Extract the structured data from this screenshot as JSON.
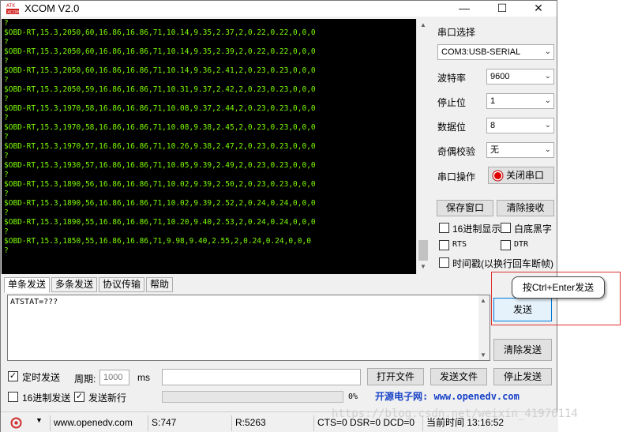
{
  "window": {
    "title": "XCOM V2.0",
    "minimize": "—",
    "maximize": "☐",
    "close": "✕"
  },
  "terminal": {
    "lines": [
      "?",
      "$OBD-RT,15.3,2050,60,16.86,16.86,71,10.14,9.35,2.37,2,0.22,0.22,0,0,0",
      "?",
      "$OBD-RT,15.3,2050,60,16.86,16.86,71,10.14,9.35,2.39,2,0.22,0.22,0,0,0",
      "?",
      "$OBD-RT,15.3,2050,60,16.86,16.86,71,10.14,9.36,2.41,2,0.23,0.23,0,0,0",
      "?",
      "$OBD-RT,15.3,2050,59,16.86,16.86,71,10.31,9.37,2.42,2,0.23,0.23,0,0,0",
      "?",
      "$OBD-RT,15.3,1970,58,16.86,16.86,71,10.08,9.37,2.44,2,0.23,0.23,0,0,0",
      "?",
      "$OBD-RT,15.3,1970,58,16.86,16.86,71,10.08,9.38,2.45,2,0.23,0.23,0,0,0",
      "?",
      "$OBD-RT,15.3,1970,57,16.86,16.86,71,10.26,9.38,2.47,2,0.23,0.23,0,0,0",
      "?",
      "$OBD-RT,15.3,1930,57,16.86,16.86,71,10.05,9.39,2.49,2,0.23,0.23,0,0,0",
      "?",
      "$OBD-RT,15.3,1890,56,16.86,16.86,71,10.02,9.39,2.50,2,0.23,0.23,0,0,0",
      "?",
      "$OBD-RT,15.3,1890,56,16.86,16.86,71,10.02,9.39,2.52,2,0.24,0.24,0,0,0",
      "?",
      "$OBD-RT,15.3,1890,55,16.86,16.86,71,10.20,9.40,2.53,2,0.24,0.24,0,0,0",
      "?",
      "$OBD-RT,15.3,1850,55,16.86,16.86,71,9.98,9.40,2.55,2,0.24,0.24,0,0,0",
      "?"
    ]
  },
  "settings": {
    "port_label": "串口选择",
    "port_value": "COM3:USB-SERIAL",
    "baud_label": "波特率",
    "baud_value": "9600",
    "stopbit_label": "停止位",
    "stopbit_value": "1",
    "databit_label": "数据位",
    "databit_value": "8",
    "parity_label": "奇偶校验",
    "parity_value": "无",
    "port_op_label": "串口操作",
    "close_port_label": "关闭串口",
    "save_window_label": "保存窗口",
    "clear_receive_label": "清除接收",
    "hex_display_label": "16进制显示",
    "white_bg_label": "白底黑字",
    "rts_label": "RTS",
    "dtr_label": "DTR",
    "timestamp_label": "时间戳(以换行回车断帧)"
  },
  "tabs": [
    "单条发送",
    "多条发送",
    "协议传输",
    "帮助"
  ],
  "send": {
    "text": "ATSTAT=???",
    "send_label": "发送",
    "clear_send_label": "清除发送",
    "tooltip": "按Ctrl+Enter发送"
  },
  "bottom": {
    "timed_send_label": "定时发送",
    "period_label": "周期:",
    "period_value": "1000",
    "period_unit": "ms",
    "open_file_label": "打开文件",
    "send_file_label": "发送文件",
    "stop_send_label": "停止发送",
    "hex_send_label": "16进制发送",
    "send_newline_label": "发送新行",
    "progress_text": "0%",
    "progress_value": 0,
    "site_link": "开源电子网: www.openedv.com"
  },
  "status": {
    "url": "www.openedv.com",
    "sent": "S:747",
    "received": "R:5263",
    "signals": "CTS=0 DSR=0 DCD=0",
    "time": "当前时间 13:16:52"
  },
  "watermark": "https://blog.csdn.net/weixin_41976114",
  "colors": {
    "terminal_bg": "#000000",
    "terminal_text": "#7cfc00",
    "callout_border": "#e03030",
    "link": "#1a44c8"
  }
}
